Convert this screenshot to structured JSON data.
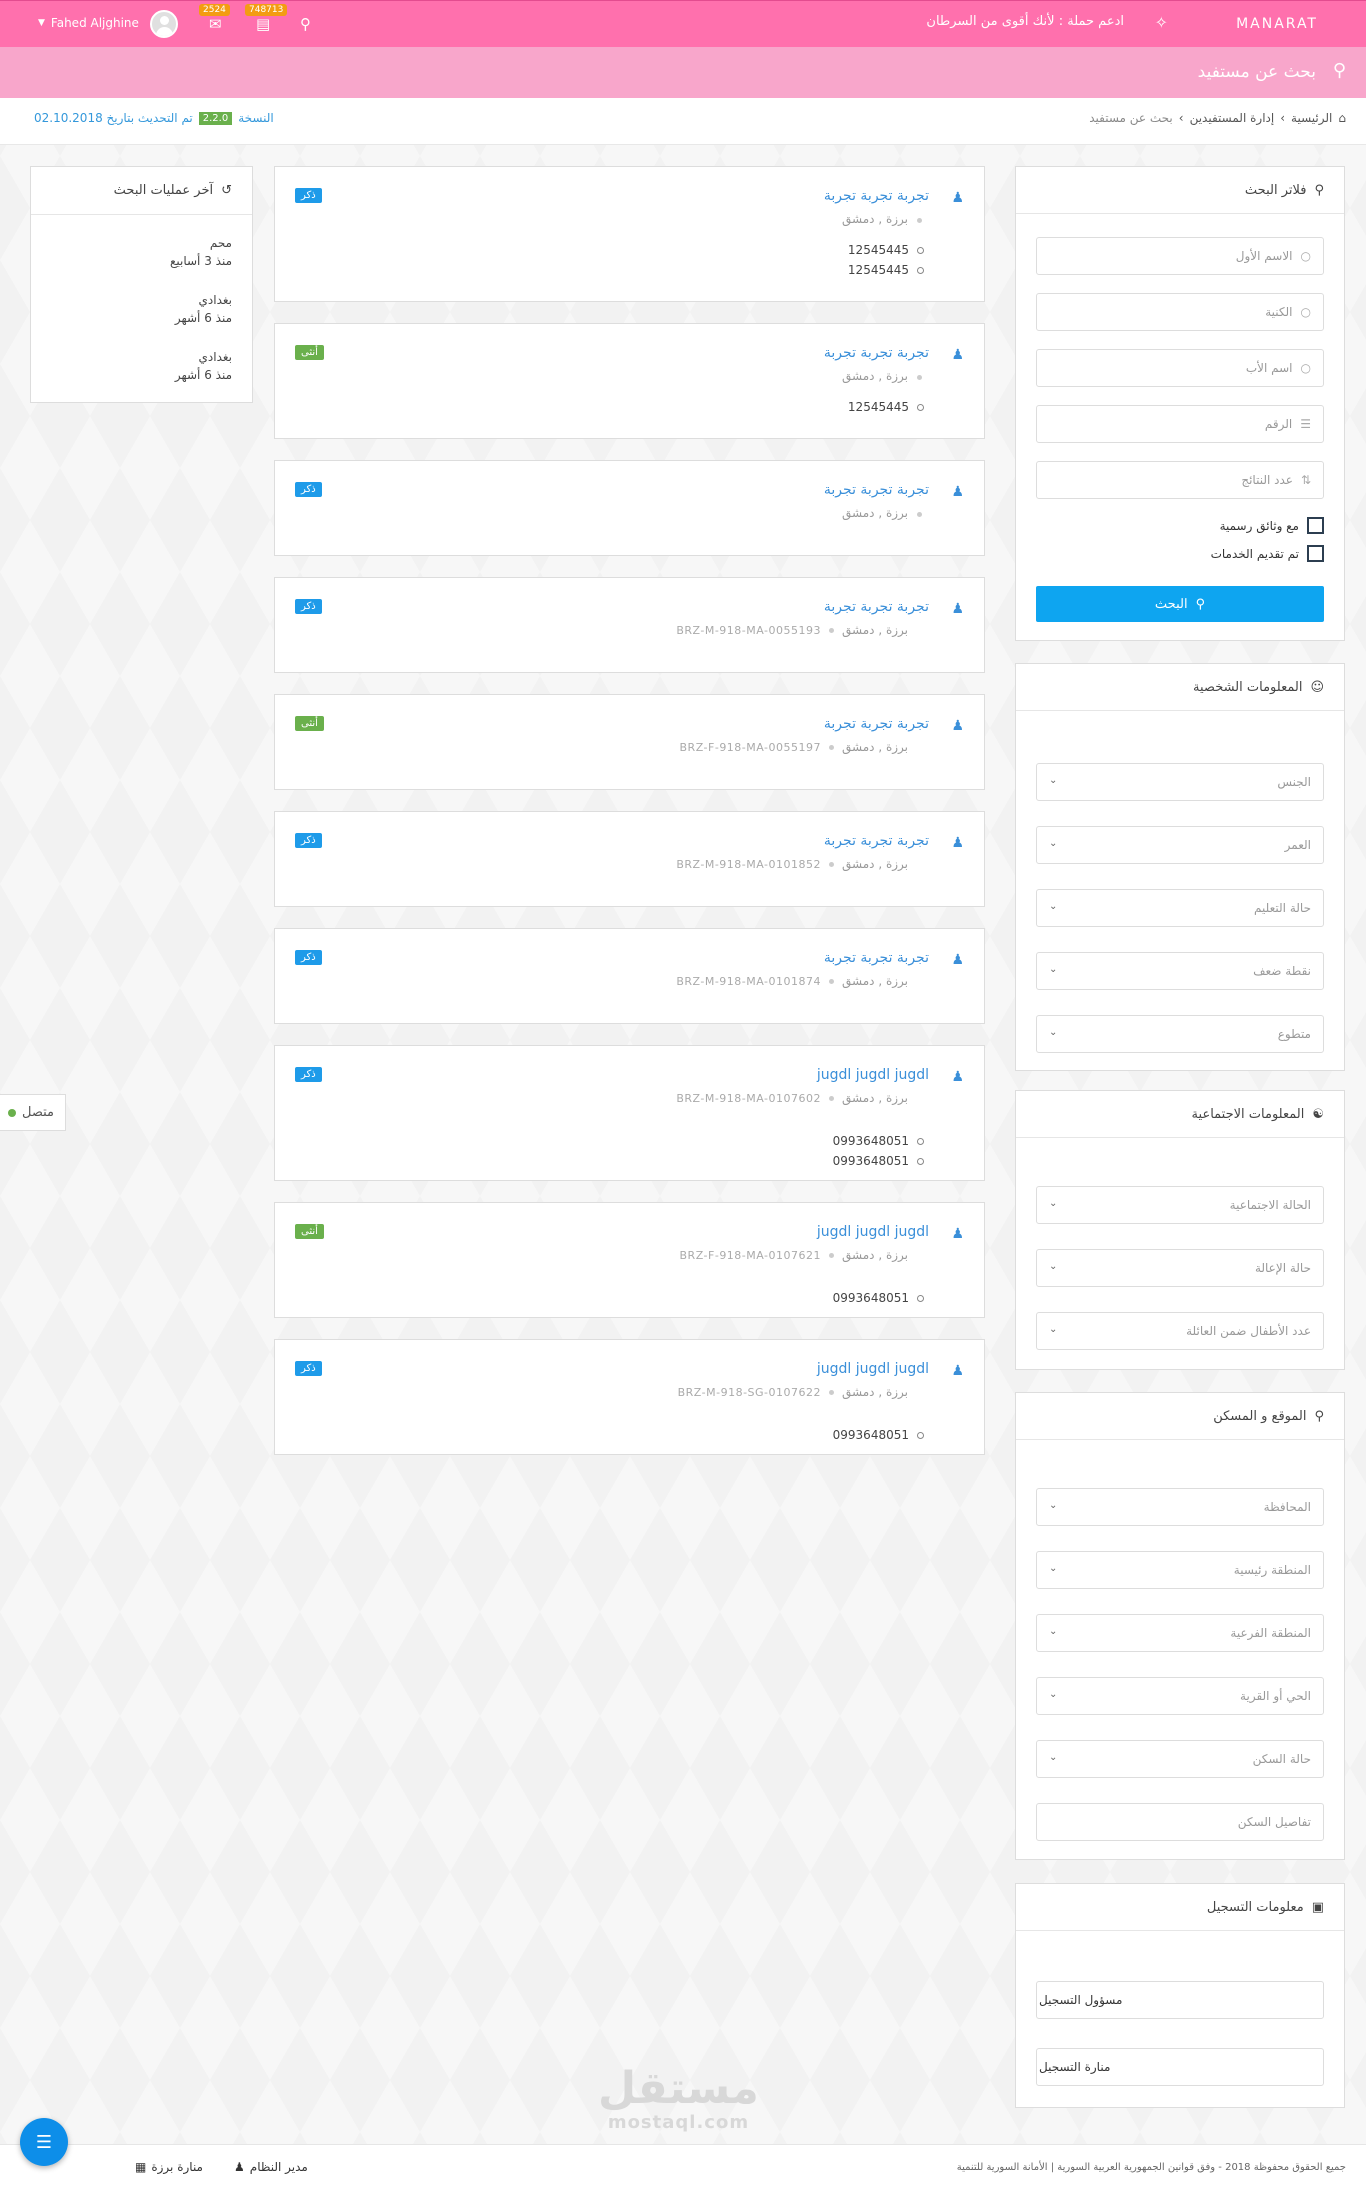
{
  "topbar": {
    "brand": "MANARAT",
    "campaign": "ادعم حملة : لأنك أقوى من السرطان",
    "user_name": "Fahed Aljghine",
    "badge_messages": "2524",
    "badge_tasks": "748713"
  },
  "search_header": {
    "title": "بحث عن مستفيد"
  },
  "breadcrumb": {
    "home": "الرئيسية",
    "section": "إدارة المستفيدين",
    "current": "بحث عن مستفيد"
  },
  "version": {
    "label": "النسخة",
    "number": "2.2.0",
    "updated": "تم التحديث بتاريخ 02.10.2018"
  },
  "filters": {
    "title": "فلاتر البحث",
    "first_name": "الاسم الأول",
    "surname": "الكنية",
    "father_name": "اسم الأب",
    "number": "الرقم",
    "results_count": "عدد النتائج",
    "official_docs": "مع وثائق رسمية",
    "services_provided": "تم تقديم الخدمات",
    "search_button": "البحث"
  },
  "personal": {
    "title": "المعلومات الشخصية",
    "gender": "الجنس",
    "age": "العمر",
    "education": "حالة التعليم",
    "weakness": "نقطة ضعف",
    "volunteer": "متطوع"
  },
  "social": {
    "title": "المعلومات الاجتماعية",
    "marital": "الحالة الاجتماعية",
    "dependency": "حالة الإعالة",
    "children": "عدد الأطفال ضمن العائلة"
  },
  "location": {
    "title": "الموقع و المسكن",
    "governorate": "المحافظة",
    "main_area": "المنطقة رئيسية",
    "sub_area": "المنطقة الفرعية",
    "neighborhood": "الحي أو القرية",
    "housing_status": "حالة السكن",
    "housing_details": "تفاصيل السكن"
  },
  "registration": {
    "title": "معلومات التسجيل",
    "officer": "مسؤول التسجيل",
    "center": "منارة التسجيل"
  },
  "results": [
    {
      "name": "تجربة تجربة تجربة",
      "gender": "ذكر",
      "location": "برزة , دمشق",
      "code": "",
      "phones": [
        "12545445",
        "12545445"
      ]
    },
    {
      "name": "تجربة تجربة تجربة",
      "gender": "أنثى",
      "location": "برزة , دمشق",
      "code": "",
      "phones": [
        "12545445"
      ]
    },
    {
      "name": "تجربة تجربة تجربة",
      "gender": "ذكر",
      "location": "برزة , دمشق",
      "code": "",
      "phones": []
    },
    {
      "name": "تجربة تجربة تجربة",
      "gender": "ذكر",
      "location": "برزة , دمشق",
      "code": "BRZ-M-918-MA-0055193",
      "phones": []
    },
    {
      "name": "تجربة تجربة تجربة",
      "gender": "أنثى",
      "location": "برزة , دمشق",
      "code": "BRZ-F-918-MA-0055197",
      "phones": []
    },
    {
      "name": "تجربة تجربة تجربة",
      "gender": "ذكر",
      "location": "برزة , دمشق",
      "code": "BRZ-M-918-MA-0101852",
      "phones": []
    },
    {
      "name": "تجربة تجربة تجربة",
      "gender": "ذكر",
      "location": "برزة , دمشق",
      "code": "BRZ-M-918-MA-0101874",
      "phones": []
    },
    {
      "name": "jugdl jugdl jugdl",
      "gender": "ذكر",
      "location": "برزة , دمشق",
      "code": "BRZ-M-918-MA-0107602",
      "phones": [
        "0993648051",
        "0993648051"
      ]
    },
    {
      "name": "jugdl jugdl jugdl",
      "gender": "أنثى",
      "location": "برزة , دمشق",
      "code": "BRZ-F-918-MA-0107621",
      "phones": [
        "0993648051"
      ]
    },
    {
      "name": "jugdl jugdl jugdl",
      "gender": "ذكر",
      "location": "برزة , دمشق",
      "code": "BRZ-M-918-SG-0107622",
      "phones": [
        "0993648051"
      ]
    }
  ],
  "history": {
    "title": "آخر عمليات البحث",
    "items": [
      {
        "name": "محم",
        "time": "منذ 3 أسابيع"
      },
      {
        "name": "بغدادي",
        "time": "منذ 6 أشهر"
      },
      {
        "name": "بغدادي",
        "time": "منذ 6 أشهر"
      }
    ]
  },
  "online": "متصل",
  "footer": {
    "copyright": "جميع الحقوق محفوظة 2018 - وفق قوانين الجمهورية العربية السورية | الأمانة السورية للتنمية",
    "admin": "مدير النظام",
    "center": "منارة برزة"
  },
  "watermark": {
    "arabic": "مستقل",
    "latin": "mostaql.com"
  },
  "colors": {
    "brand_pink": "#ff70ad",
    "header_pink": "#f8a6cb",
    "male": "#1e9be9",
    "female": "#6ab04c",
    "primary": "#0ea5f0"
  },
  "icons": {
    "search": "search-icon",
    "home": "home-icon",
    "user": "user-icon",
    "history": "history-icon",
    "chevron": "chevron-down-icon"
  }
}
